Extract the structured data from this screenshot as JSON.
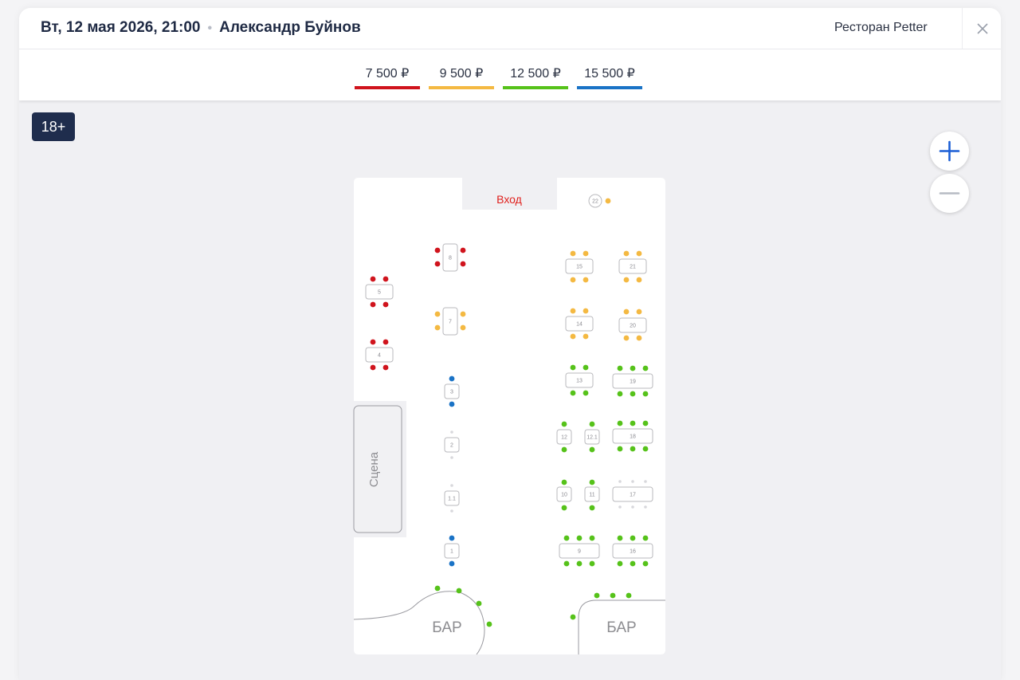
{
  "header": {
    "datetime": "Вт, 12 мая 2026, 21:00",
    "separator": "•",
    "performer": "Александр Буйнов",
    "venue": "Ресторан Petter",
    "close_icon": "close-icon"
  },
  "price_legend": [
    {
      "label": "7 500 ₽",
      "color": "#d0141d"
    },
    {
      "label": "9 500 ₽",
      "color": "#f4b942"
    },
    {
      "label": "12 500 ₽",
      "color": "#56c21a"
    },
    {
      "label": "15 500 ₽",
      "color": "#1a73c6"
    }
  ],
  "age_badge": "18+",
  "zoom": {
    "in_icon": "plus-icon",
    "out_icon": "minus-icon"
  },
  "hall": {
    "entrance": "Вход",
    "stage": "Сцена",
    "bar_left": "БАР",
    "bar_right": "БАР",
    "tables": [
      "22",
      "8",
      "5",
      "7",
      "4",
      "3",
      "2",
      "1.1",
      "1",
      "15",
      "21",
      "14",
      "20",
      "13",
      "19",
      "12",
      "12.1",
      "18",
      "10",
      "11",
      "17",
      "9",
      "16"
    ]
  }
}
